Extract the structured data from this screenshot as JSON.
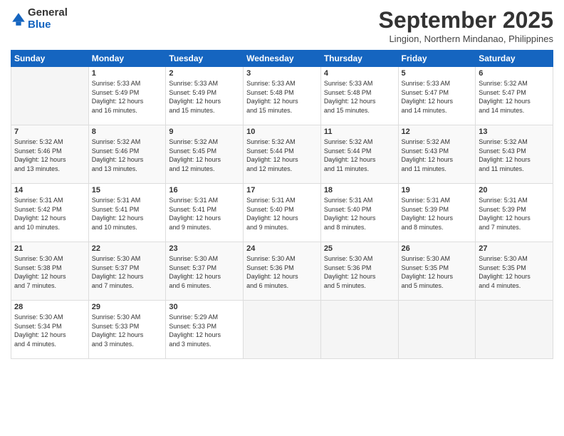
{
  "logo": {
    "general": "General",
    "blue": "Blue"
  },
  "title": "September 2025",
  "location": "Lingion, Northern Mindanao, Philippines",
  "days_header": [
    "Sunday",
    "Monday",
    "Tuesday",
    "Wednesday",
    "Thursday",
    "Friday",
    "Saturday"
  ],
  "weeks": [
    [
      {
        "num": "",
        "info": ""
      },
      {
        "num": "1",
        "info": "Sunrise: 5:33 AM\nSunset: 5:49 PM\nDaylight: 12 hours\nand 16 minutes."
      },
      {
        "num": "2",
        "info": "Sunrise: 5:33 AM\nSunset: 5:49 PM\nDaylight: 12 hours\nand 15 minutes."
      },
      {
        "num": "3",
        "info": "Sunrise: 5:33 AM\nSunset: 5:48 PM\nDaylight: 12 hours\nand 15 minutes."
      },
      {
        "num": "4",
        "info": "Sunrise: 5:33 AM\nSunset: 5:48 PM\nDaylight: 12 hours\nand 15 minutes."
      },
      {
        "num": "5",
        "info": "Sunrise: 5:33 AM\nSunset: 5:47 PM\nDaylight: 12 hours\nand 14 minutes."
      },
      {
        "num": "6",
        "info": "Sunrise: 5:32 AM\nSunset: 5:47 PM\nDaylight: 12 hours\nand 14 minutes."
      }
    ],
    [
      {
        "num": "7",
        "info": "Sunrise: 5:32 AM\nSunset: 5:46 PM\nDaylight: 12 hours\nand 13 minutes."
      },
      {
        "num": "8",
        "info": "Sunrise: 5:32 AM\nSunset: 5:46 PM\nDaylight: 12 hours\nand 13 minutes."
      },
      {
        "num": "9",
        "info": "Sunrise: 5:32 AM\nSunset: 5:45 PM\nDaylight: 12 hours\nand 12 minutes."
      },
      {
        "num": "10",
        "info": "Sunrise: 5:32 AM\nSunset: 5:44 PM\nDaylight: 12 hours\nand 12 minutes."
      },
      {
        "num": "11",
        "info": "Sunrise: 5:32 AM\nSunset: 5:44 PM\nDaylight: 12 hours\nand 11 minutes."
      },
      {
        "num": "12",
        "info": "Sunrise: 5:32 AM\nSunset: 5:43 PM\nDaylight: 12 hours\nand 11 minutes."
      },
      {
        "num": "13",
        "info": "Sunrise: 5:32 AM\nSunset: 5:43 PM\nDaylight: 12 hours\nand 11 minutes."
      }
    ],
    [
      {
        "num": "14",
        "info": "Sunrise: 5:31 AM\nSunset: 5:42 PM\nDaylight: 12 hours\nand 10 minutes."
      },
      {
        "num": "15",
        "info": "Sunrise: 5:31 AM\nSunset: 5:41 PM\nDaylight: 12 hours\nand 10 minutes."
      },
      {
        "num": "16",
        "info": "Sunrise: 5:31 AM\nSunset: 5:41 PM\nDaylight: 12 hours\nand 9 minutes."
      },
      {
        "num": "17",
        "info": "Sunrise: 5:31 AM\nSunset: 5:40 PM\nDaylight: 12 hours\nand 9 minutes."
      },
      {
        "num": "18",
        "info": "Sunrise: 5:31 AM\nSunset: 5:40 PM\nDaylight: 12 hours\nand 8 minutes."
      },
      {
        "num": "19",
        "info": "Sunrise: 5:31 AM\nSunset: 5:39 PM\nDaylight: 12 hours\nand 8 minutes."
      },
      {
        "num": "20",
        "info": "Sunrise: 5:31 AM\nSunset: 5:39 PM\nDaylight: 12 hours\nand 7 minutes."
      }
    ],
    [
      {
        "num": "21",
        "info": "Sunrise: 5:30 AM\nSunset: 5:38 PM\nDaylight: 12 hours\nand 7 minutes."
      },
      {
        "num": "22",
        "info": "Sunrise: 5:30 AM\nSunset: 5:37 PM\nDaylight: 12 hours\nand 7 minutes."
      },
      {
        "num": "23",
        "info": "Sunrise: 5:30 AM\nSunset: 5:37 PM\nDaylight: 12 hours\nand 6 minutes."
      },
      {
        "num": "24",
        "info": "Sunrise: 5:30 AM\nSunset: 5:36 PM\nDaylight: 12 hours\nand 6 minutes."
      },
      {
        "num": "25",
        "info": "Sunrise: 5:30 AM\nSunset: 5:36 PM\nDaylight: 12 hours\nand 5 minutes."
      },
      {
        "num": "26",
        "info": "Sunrise: 5:30 AM\nSunset: 5:35 PM\nDaylight: 12 hours\nand 5 minutes."
      },
      {
        "num": "27",
        "info": "Sunrise: 5:30 AM\nSunset: 5:35 PM\nDaylight: 12 hours\nand 4 minutes."
      }
    ],
    [
      {
        "num": "28",
        "info": "Sunrise: 5:30 AM\nSunset: 5:34 PM\nDaylight: 12 hours\nand 4 minutes."
      },
      {
        "num": "29",
        "info": "Sunrise: 5:30 AM\nSunset: 5:33 PM\nDaylight: 12 hours\nand 3 minutes."
      },
      {
        "num": "30",
        "info": "Sunrise: 5:29 AM\nSunset: 5:33 PM\nDaylight: 12 hours\nand 3 minutes."
      },
      {
        "num": "",
        "info": ""
      },
      {
        "num": "",
        "info": ""
      },
      {
        "num": "",
        "info": ""
      },
      {
        "num": "",
        "info": ""
      }
    ]
  ]
}
